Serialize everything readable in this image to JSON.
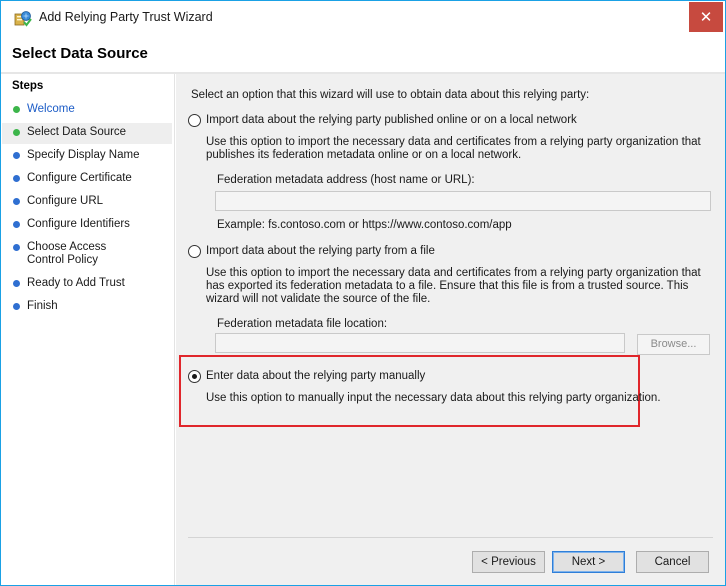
{
  "window": {
    "title": "Add Relying Party Trust Wizard",
    "close_glyph": "✕",
    "accent_color": "#1aa1e5",
    "close_color": "#c74a3f",
    "icon": "relying-party-trust-icon"
  },
  "page": {
    "title": "Select Data Source"
  },
  "steps": {
    "heading": "Steps",
    "items": [
      {
        "label": "Welcome",
        "state": "done-link"
      },
      {
        "label": "Select Data Source",
        "state": "current"
      },
      {
        "label": "Specify Display Name",
        "state": "pending"
      },
      {
        "label": "Configure Certificate",
        "state": "pending"
      },
      {
        "label": "Configure URL",
        "state": "pending"
      },
      {
        "label": "Configure Identifiers",
        "state": "pending"
      },
      {
        "label": "Choose Access Control Policy",
        "state": "pending"
      },
      {
        "label": "Ready to Add Trust",
        "state": "pending"
      },
      {
        "label": "Finish",
        "state": "pending"
      }
    ]
  },
  "content": {
    "intro": "Select an option that this wizard will use to obtain data about this relying party:",
    "options": [
      {
        "label": "Import data about the relying party published online or on a local network",
        "description": "Use this option to import the necessary data and certificates from a relying party organization that publishes its federation metadata online or on a local network.",
        "field_label": "Federation metadata address (host name or URL):",
        "field_value": "",
        "example": "Example: fs.contoso.com or https://www.contoso.com/app",
        "selected": false
      },
      {
        "label": "Import data about the relying party from a file",
        "description": "Use this option to import the necessary data and certificates from a relying party organization that has exported its federation metadata to a file. Ensure that this file is from a trusted source.  This wizard will not validate the source of the file.",
        "field_label": "Federation metadata file location:",
        "field_value": "",
        "browse_label": "Browse...",
        "selected": false
      },
      {
        "label": "Enter data about the relying party manually",
        "description": "Use this option to manually input the necessary data about this relying party organization.",
        "selected": true
      }
    ],
    "highlight_color": "#e0262b"
  },
  "footer": {
    "previous_label": "< Previous",
    "next_label": "Next >",
    "cancel_label": "Cancel"
  }
}
